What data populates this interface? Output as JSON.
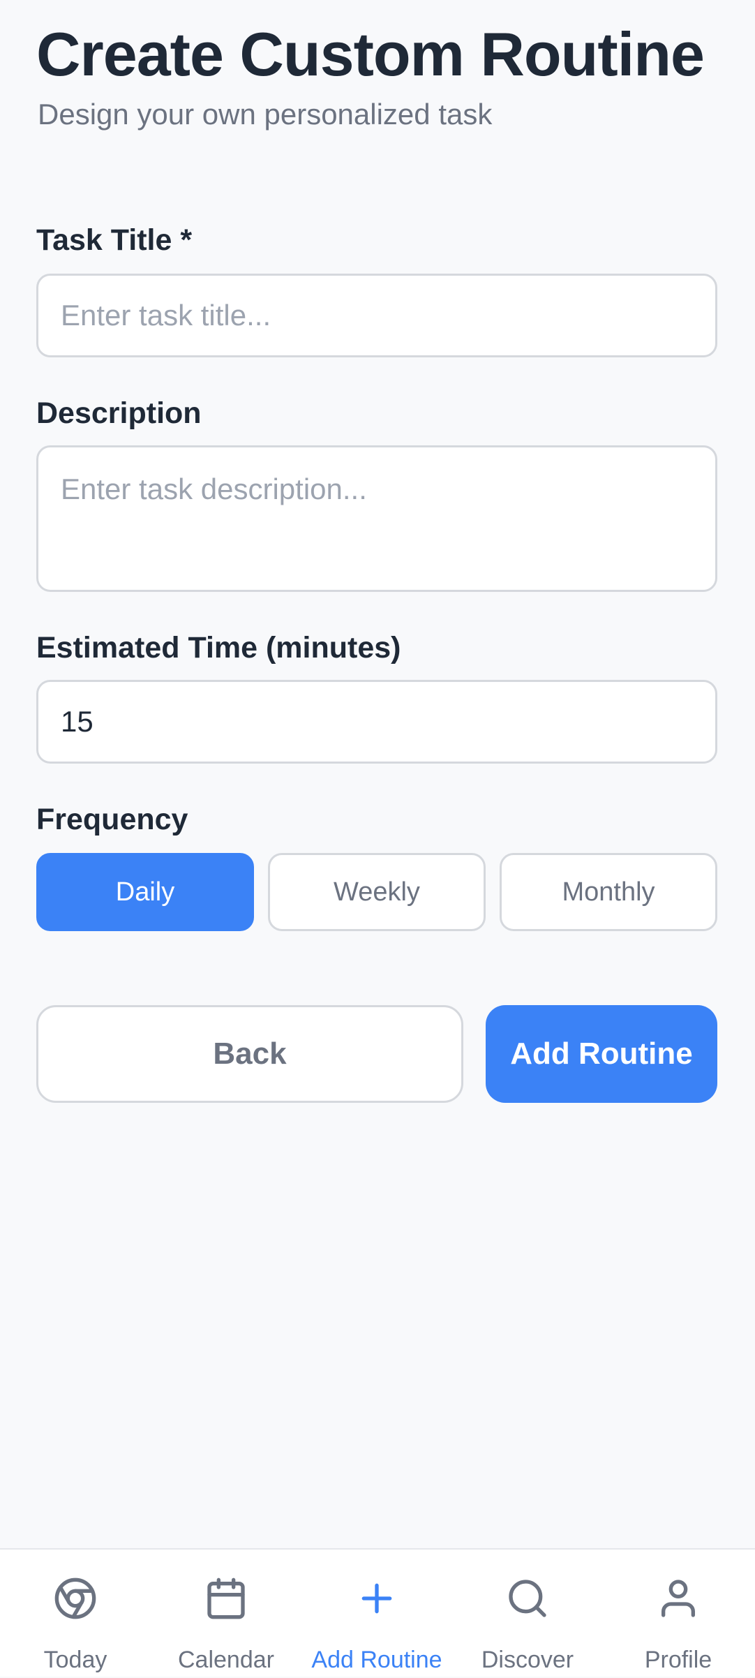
{
  "header": {
    "title": "Create Custom Routine",
    "subtitle": "Design your own personalized task"
  },
  "form": {
    "task_title": {
      "label": "Task Title *",
      "placeholder": "Enter task title...",
      "value": ""
    },
    "description": {
      "label": "Description",
      "placeholder": "Enter task description...",
      "value": ""
    },
    "estimated_time": {
      "label": "Estimated Time (minutes)",
      "value": "15"
    },
    "frequency": {
      "label": "Frequency",
      "options": [
        "Daily",
        "Weekly",
        "Monthly"
      ],
      "selected": "Daily"
    }
  },
  "actions": {
    "back_label": "Back",
    "add_label": "Add Routine"
  },
  "colors": {
    "accent": "#3b82f6",
    "background": "#f8f9fb",
    "text": "#1f2937",
    "muted": "#6b7280"
  },
  "bottom_nav": {
    "items": [
      {
        "label": "Today",
        "icon": "chrome-icon",
        "active": false
      },
      {
        "label": "Calendar",
        "icon": "calendar-icon",
        "active": false
      },
      {
        "label": "Add Routine",
        "icon": "plus-icon",
        "active": true
      },
      {
        "label": "Discover",
        "icon": "search-icon",
        "active": false
      },
      {
        "label": "Profile",
        "icon": "user-icon",
        "active": false
      }
    ]
  }
}
